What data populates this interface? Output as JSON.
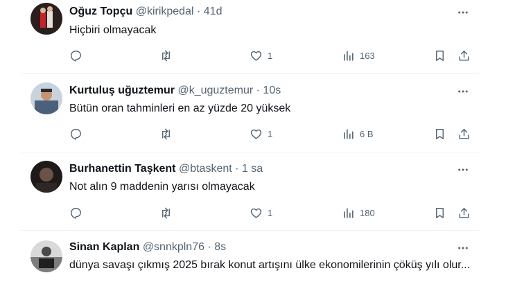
{
  "tweets": [
    {
      "name": "Oğuz Topçu",
      "handle": "@kirikpedal",
      "dot": "·",
      "time": "41d",
      "text": "Hiçbiri olmayacak",
      "likes": "1",
      "views": "163",
      "avatar_color": "#7a2f3a"
    },
    {
      "name": "Kurtuluş uğuztemur",
      "handle": "@k_uguztemur",
      "dot": "·",
      "time": "10s",
      "text": "Bütün oran tahminleri en az yüzde 20 yüksek",
      "likes": "1",
      "views": "6 B",
      "avatar_color": "#5a6f86"
    },
    {
      "name": "Burhanettin Taşkent",
      "handle": "@btaskent",
      "dot": "·",
      "time": "1 sa",
      "text": "Not alın 9 maddenin yarısı olmayacak",
      "likes": "1",
      "views": "180",
      "avatar_color": "#3b3330"
    },
    {
      "name": "Sinan Kaplan",
      "handle": "@snnkpln76",
      "dot": "·",
      "time": "8s",
      "text": "dünya savaşı çıkmış  2025 bırak konut artışını ülke ekonomilerinin çöküş yılı olur...",
      "avatar_color": "#9a9a9a"
    }
  ],
  "icons": {
    "reply": "reply-icon",
    "retweet": "retweet-icon",
    "like": "heart-icon",
    "views": "views-chart-icon",
    "bookmark": "bookmark-icon",
    "share": "share-icon",
    "more": "more-dots-icon"
  },
  "colors": {
    "text": "#0f1419",
    "secondary": "#536471",
    "divider": "#eff3f4"
  }
}
